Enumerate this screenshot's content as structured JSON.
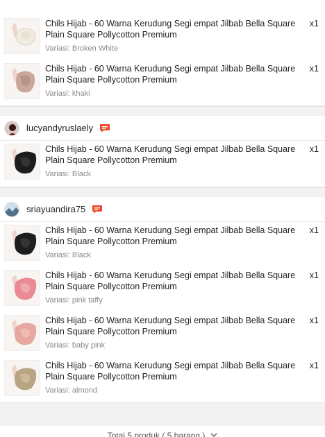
{
  "product_title": "Chils Hijab - 60 Warna Kerudung Segi empat Jilbab Bella Square Plain Square Pollycotton Premium",
  "orders": [
    {
      "shop": null,
      "items": [
        {
          "title": "Chils Hijab - 60 Warna Kerudung Segi empat Jilbab Bella Square Plain Square Pollycotton Premium",
          "variant": "Variasi: Broken White",
          "qty": "x1",
          "color": "#f3efe7"
        },
        {
          "title": "Chils Hijab - 60 Warna Kerudung Segi empat Jilbab Bella Square Plain Square Pollycotton Premium",
          "variant": "Variasi: khaki",
          "qty": "x1",
          "color": "#c9a79a"
        }
      ]
    },
    {
      "shop": {
        "name": "lucyandyruslaely",
        "avatar_color": "#5a2a2a"
      },
      "items": [
        {
          "title": "Chils Hijab - 60 Warna Kerudung Segi empat Jilbab Bella Square Plain Square Pollycotton Premium",
          "variant": "Variasi: Black",
          "qty": "x1",
          "color": "#1d1d1d"
        }
      ]
    },
    {
      "shop": {
        "name": "sriayuandira75",
        "avatar_color": "#6b8fa8"
      },
      "items": [
        {
          "title": "Chils Hijab - 60 Warna Kerudung Segi empat Jilbab Bella Square Plain Square Pollycotton Premium",
          "variant": "Variasi: Black",
          "qty": "x1",
          "color": "#1d1d1d"
        },
        {
          "title": "Chils Hijab - 60 Warna Kerudung Segi empat Jilbab Bella Square Plain Square Pollycotton Premium",
          "variant": "Variasi: pink taffy",
          "qty": "x1",
          "color": "#e98a95"
        },
        {
          "title": "Chils Hijab - 60 Warna Kerudung Segi empat Jilbab Bella Square Plain Square Pollycotton Premium",
          "variant": "Variasi: baby pink",
          "qty": "x1",
          "color": "#e6a7a0"
        },
        {
          "title": "Chils Hijab - 60 Warna Kerudung Segi empat Jilbab Bella Square Plain Square Pollycotton Premium",
          "variant": "Variasi: almond",
          "qty": "x1",
          "color": "#b8a584"
        }
      ]
    }
  ],
  "footer": {
    "summary": "Total 5 produk ( 5 barang )"
  },
  "accent_color": "#ee4d2d"
}
